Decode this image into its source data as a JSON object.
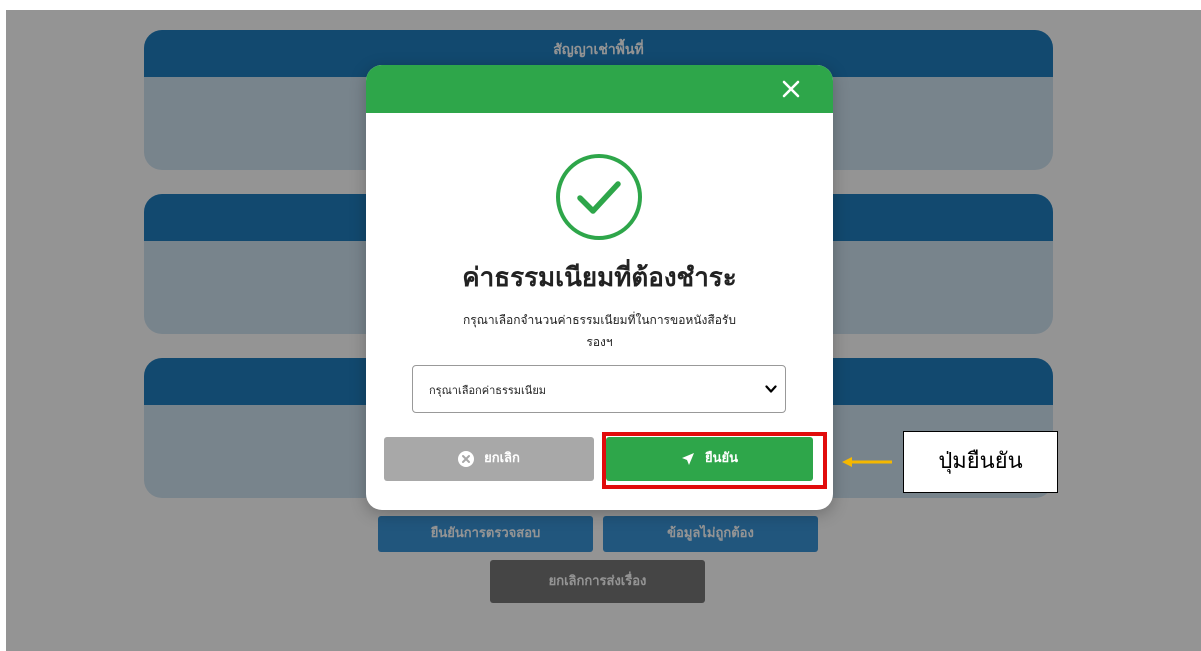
{
  "background": {
    "cards": [
      {
        "title": "สัญญาเช่าพื้นที่"
      },
      {
        "title": ""
      },
      {
        "title": ""
      }
    ],
    "buttons": {
      "confirm_check": "ยืนยันการตรวจสอบ",
      "incorrect_info": "ข้อมูลไม่ถูกต้อง",
      "cancel_submission": "ยกเลิกการส่งเรื่อง"
    }
  },
  "modal": {
    "close_icon": "close-icon",
    "success_icon": "check-circle-icon",
    "title": "ค่าธรรมเนียมที่ต้องชำระ",
    "description_line1": "กรุณาเลือกจำนวนค่าธรรมเนียมที่ในการขอหนังสือรับ",
    "description_line2": "รองฯ",
    "select_value": "กรุณาเลือกค่าธรรมเนียม",
    "cancel_label": "ยกเลิก",
    "confirm_label": "ยืนยัน"
  },
  "annotation": {
    "callout_text": "ปุ่มยืนยัน"
  },
  "colors": {
    "modal_header": "#2ea64a",
    "confirm_button": "#2ea64a",
    "cancel_button": "#a8a8a8",
    "card_header": "#1f7fc0",
    "highlight_border": "#e10c0c",
    "arrow": "#f5b800"
  }
}
